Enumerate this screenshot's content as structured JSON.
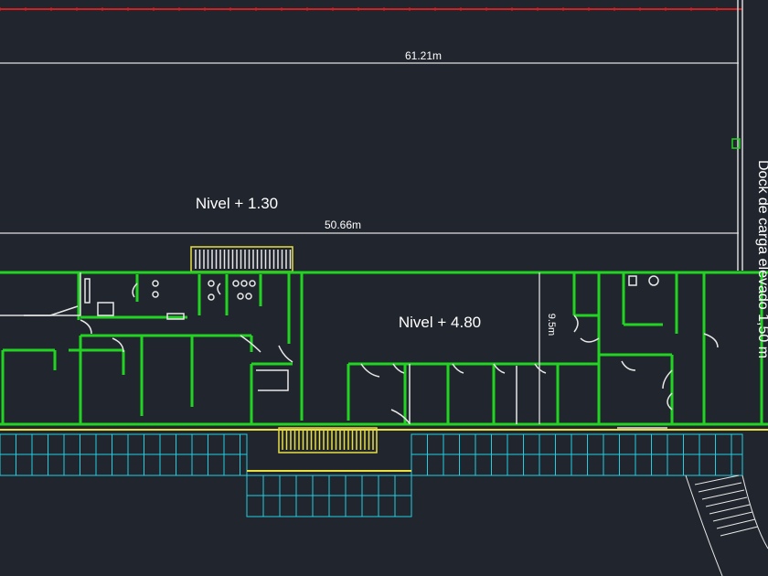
{
  "drawing": {
    "dimensions": {
      "overall_length": "61.21m",
      "building_length": "50.66m",
      "building_depth": "9.5m"
    },
    "levels": {
      "lower": "Nivel + 1.30",
      "upper": "Nivel + 4.80"
    },
    "dock_label": "Dock de carga elevado 1,50 m"
  },
  "colors": {
    "background": "#21252e",
    "walls": "#22d422",
    "doors": "#e8e040",
    "fixtures": "#e8e8e8",
    "boundary": "#d42020",
    "terrace_grid": "#20d0e0"
  }
}
